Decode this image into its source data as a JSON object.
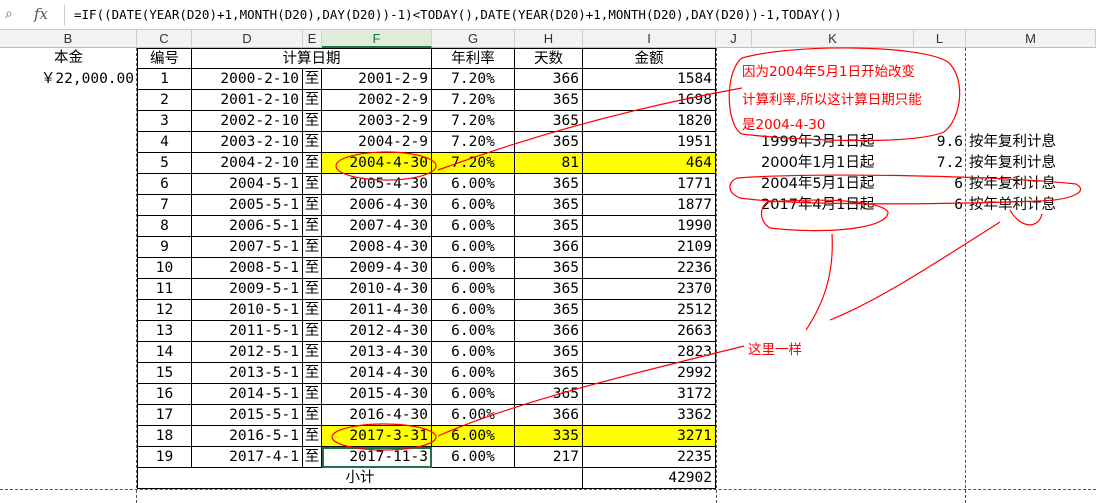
{
  "formula_bar": {
    "fx_label": "fx",
    "formula": "=IF((DATE(YEAR(D20)+1,MONTH(D20),DAY(D20))-1)<TODAY(),DATE(YEAR(D20)+1,MONTH(D20),DAY(D20))-1,TODAY())"
  },
  "columns": [
    "B",
    "C",
    "D",
    "E",
    "F",
    "G",
    "H",
    "I",
    "J",
    "K",
    "L",
    "M"
  ],
  "active_column": "F",
  "header": {
    "principal": "本金",
    "no": "编号",
    "period": "计算日期",
    "rate": "年利率",
    "days": "天数",
    "amount": "金额"
  },
  "principal_value": "￥22,000.00",
  "rows": [
    {
      "no": "1",
      "start": "2000-2-10",
      "to": "至",
      "end": "2001-2-9",
      "rate": "7.20%",
      "days": "366",
      "amount": "1584"
    },
    {
      "no": "2",
      "start": "2001-2-10",
      "to": "至",
      "end": "2002-2-9",
      "rate": "7.20%",
      "days": "365",
      "amount": "1698"
    },
    {
      "no": "3",
      "start": "2002-2-10",
      "to": "至",
      "end": "2003-2-9",
      "rate": "7.20%",
      "days": "365",
      "amount": "1820"
    },
    {
      "no": "4",
      "start": "2003-2-10",
      "to": "至",
      "end": "2004-2-9",
      "rate": "7.20%",
      "days": "365",
      "amount": "1951"
    },
    {
      "no": "5",
      "start": "2004-2-10",
      "to": "至",
      "end": "2004-4-30",
      "rate": "7.20%",
      "days": "81",
      "amount": "464"
    },
    {
      "no": "6",
      "start": "2004-5-1",
      "to": "至",
      "end": "2005-4-30",
      "rate": "6.00%",
      "days": "365",
      "amount": "1771"
    },
    {
      "no": "7",
      "start": "2005-5-1",
      "to": "至",
      "end": "2006-4-30",
      "rate": "6.00%",
      "days": "365",
      "amount": "1877"
    },
    {
      "no": "8",
      "start": "2006-5-1",
      "to": "至",
      "end": "2007-4-30",
      "rate": "6.00%",
      "days": "365",
      "amount": "1990"
    },
    {
      "no": "9",
      "start": "2007-5-1",
      "to": "至",
      "end": "2008-4-30",
      "rate": "6.00%",
      "days": "366",
      "amount": "2109"
    },
    {
      "no": "10",
      "start": "2008-5-1",
      "to": "至",
      "end": "2009-4-30",
      "rate": "6.00%",
      "days": "365",
      "amount": "2236"
    },
    {
      "no": "11",
      "start": "2009-5-1",
      "to": "至",
      "end": "2010-4-30",
      "rate": "6.00%",
      "days": "365",
      "amount": "2370"
    },
    {
      "no": "12",
      "start": "2010-5-1",
      "to": "至",
      "end": "2011-4-30",
      "rate": "6.00%",
      "days": "365",
      "amount": "2512"
    },
    {
      "no": "13",
      "start": "2011-5-1",
      "to": "至",
      "end": "2012-4-30",
      "rate": "6.00%",
      "days": "366",
      "amount": "2663"
    },
    {
      "no": "14",
      "start": "2012-5-1",
      "to": "至",
      "end": "2013-4-30",
      "rate": "6.00%",
      "days": "365",
      "amount": "2823"
    },
    {
      "no": "15",
      "start": "2013-5-1",
      "to": "至",
      "end": "2014-4-30",
      "rate": "6.00%",
      "days": "365",
      "amount": "2992"
    },
    {
      "no": "16",
      "start": "2014-5-1",
      "to": "至",
      "end": "2015-4-30",
      "rate": "6.00%",
      "days": "365",
      "amount": "3172"
    },
    {
      "no": "17",
      "start": "2015-5-1",
      "to": "至",
      "end": "2016-4-30",
      "rate": "6.00%",
      "days": "366",
      "amount": "3362"
    },
    {
      "no": "18",
      "start": "2016-5-1",
      "to": "至",
      "end": "2017-3-31",
      "rate": "6.00%",
      "days": "335",
      "amount": "3271"
    },
    {
      "no": "19",
      "start": "2017-4-1",
      "to": "至",
      "end": "2017-11-3",
      "rate": "6.00%",
      "days": "217",
      "amount": "2235"
    }
  ],
  "subtotal": {
    "label": "小计",
    "amount": "42902"
  },
  "side_table": [
    {
      "date": "1999年3月1日起",
      "rate": "9.6",
      "method": "按年复利计息"
    },
    {
      "date": "2000年1月1日起",
      "rate": "7.2",
      "method": "按年复利计息"
    },
    {
      "date": "2004年5月1日起",
      "rate": "6",
      "method": "按年复利计息"
    },
    {
      "date": "2017年4月1日起",
      "rate": "6",
      "method": "按年单利计息"
    }
  ],
  "annotations": {
    "note_line1": "因为2004年5月1日开始改变",
    "note_line2": "计算利率,所以这计算日期只能",
    "note_line3": "是2004-4-30",
    "same_here": "这里一样"
  },
  "colors": {
    "highlight": "#ffff00",
    "annotation": "#ff0000",
    "selection": "#217346"
  },
  "yellow_rows": [
    "5",
    "18"
  ]
}
